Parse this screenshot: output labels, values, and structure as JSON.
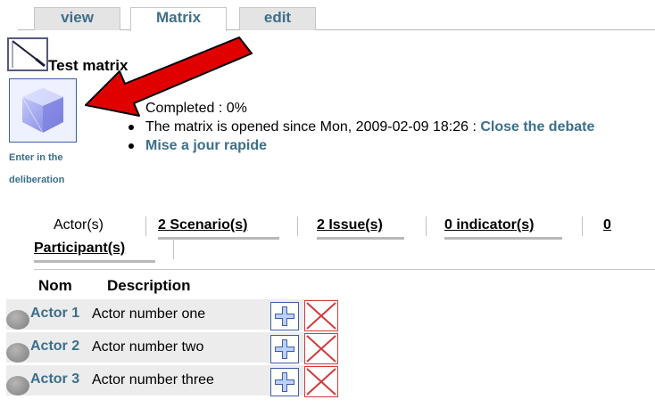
{
  "tabs": [
    {
      "label": "view",
      "active": false
    },
    {
      "label": "Matrix",
      "active": true
    },
    {
      "label": "edit",
      "active": false
    }
  ],
  "header": {
    "title": "Test matrix",
    "icon": "matrix-graph-icon"
  },
  "deliberation": {
    "label_line1": "Enter in the",
    "label_line2": "deliberation",
    "icon": "cube-icon"
  },
  "info": {
    "completed": "Completed : 0%",
    "opened_text": "The matrix is opened since Mon, 2009-02-09 18:26 : ",
    "close_link": "Close the debate",
    "quick_update": "Mise a jour rapide"
  },
  "subtabs": {
    "actor": "Actor(s)",
    "scenario": "2 Scenario(s)",
    "issue": "2 Issue(s)",
    "indicator": "0 indicator(s)",
    "participant_count": "0",
    "participant_label": "Participant(s)"
  },
  "table": {
    "headers": {
      "nom": "Nom",
      "description": "Description"
    },
    "rows": [
      {
        "name": "Actor 1",
        "description": "Actor number one"
      },
      {
        "name": "Actor 2",
        "description": "Actor number two"
      },
      {
        "name": "Actor 3",
        "description": "Actor number three"
      }
    ]
  },
  "colors": {
    "link": "#3b6f8c",
    "arrow": "#e00000",
    "move_button_border": "#3c5fa8",
    "delete_button_border": "#d13a3a"
  }
}
